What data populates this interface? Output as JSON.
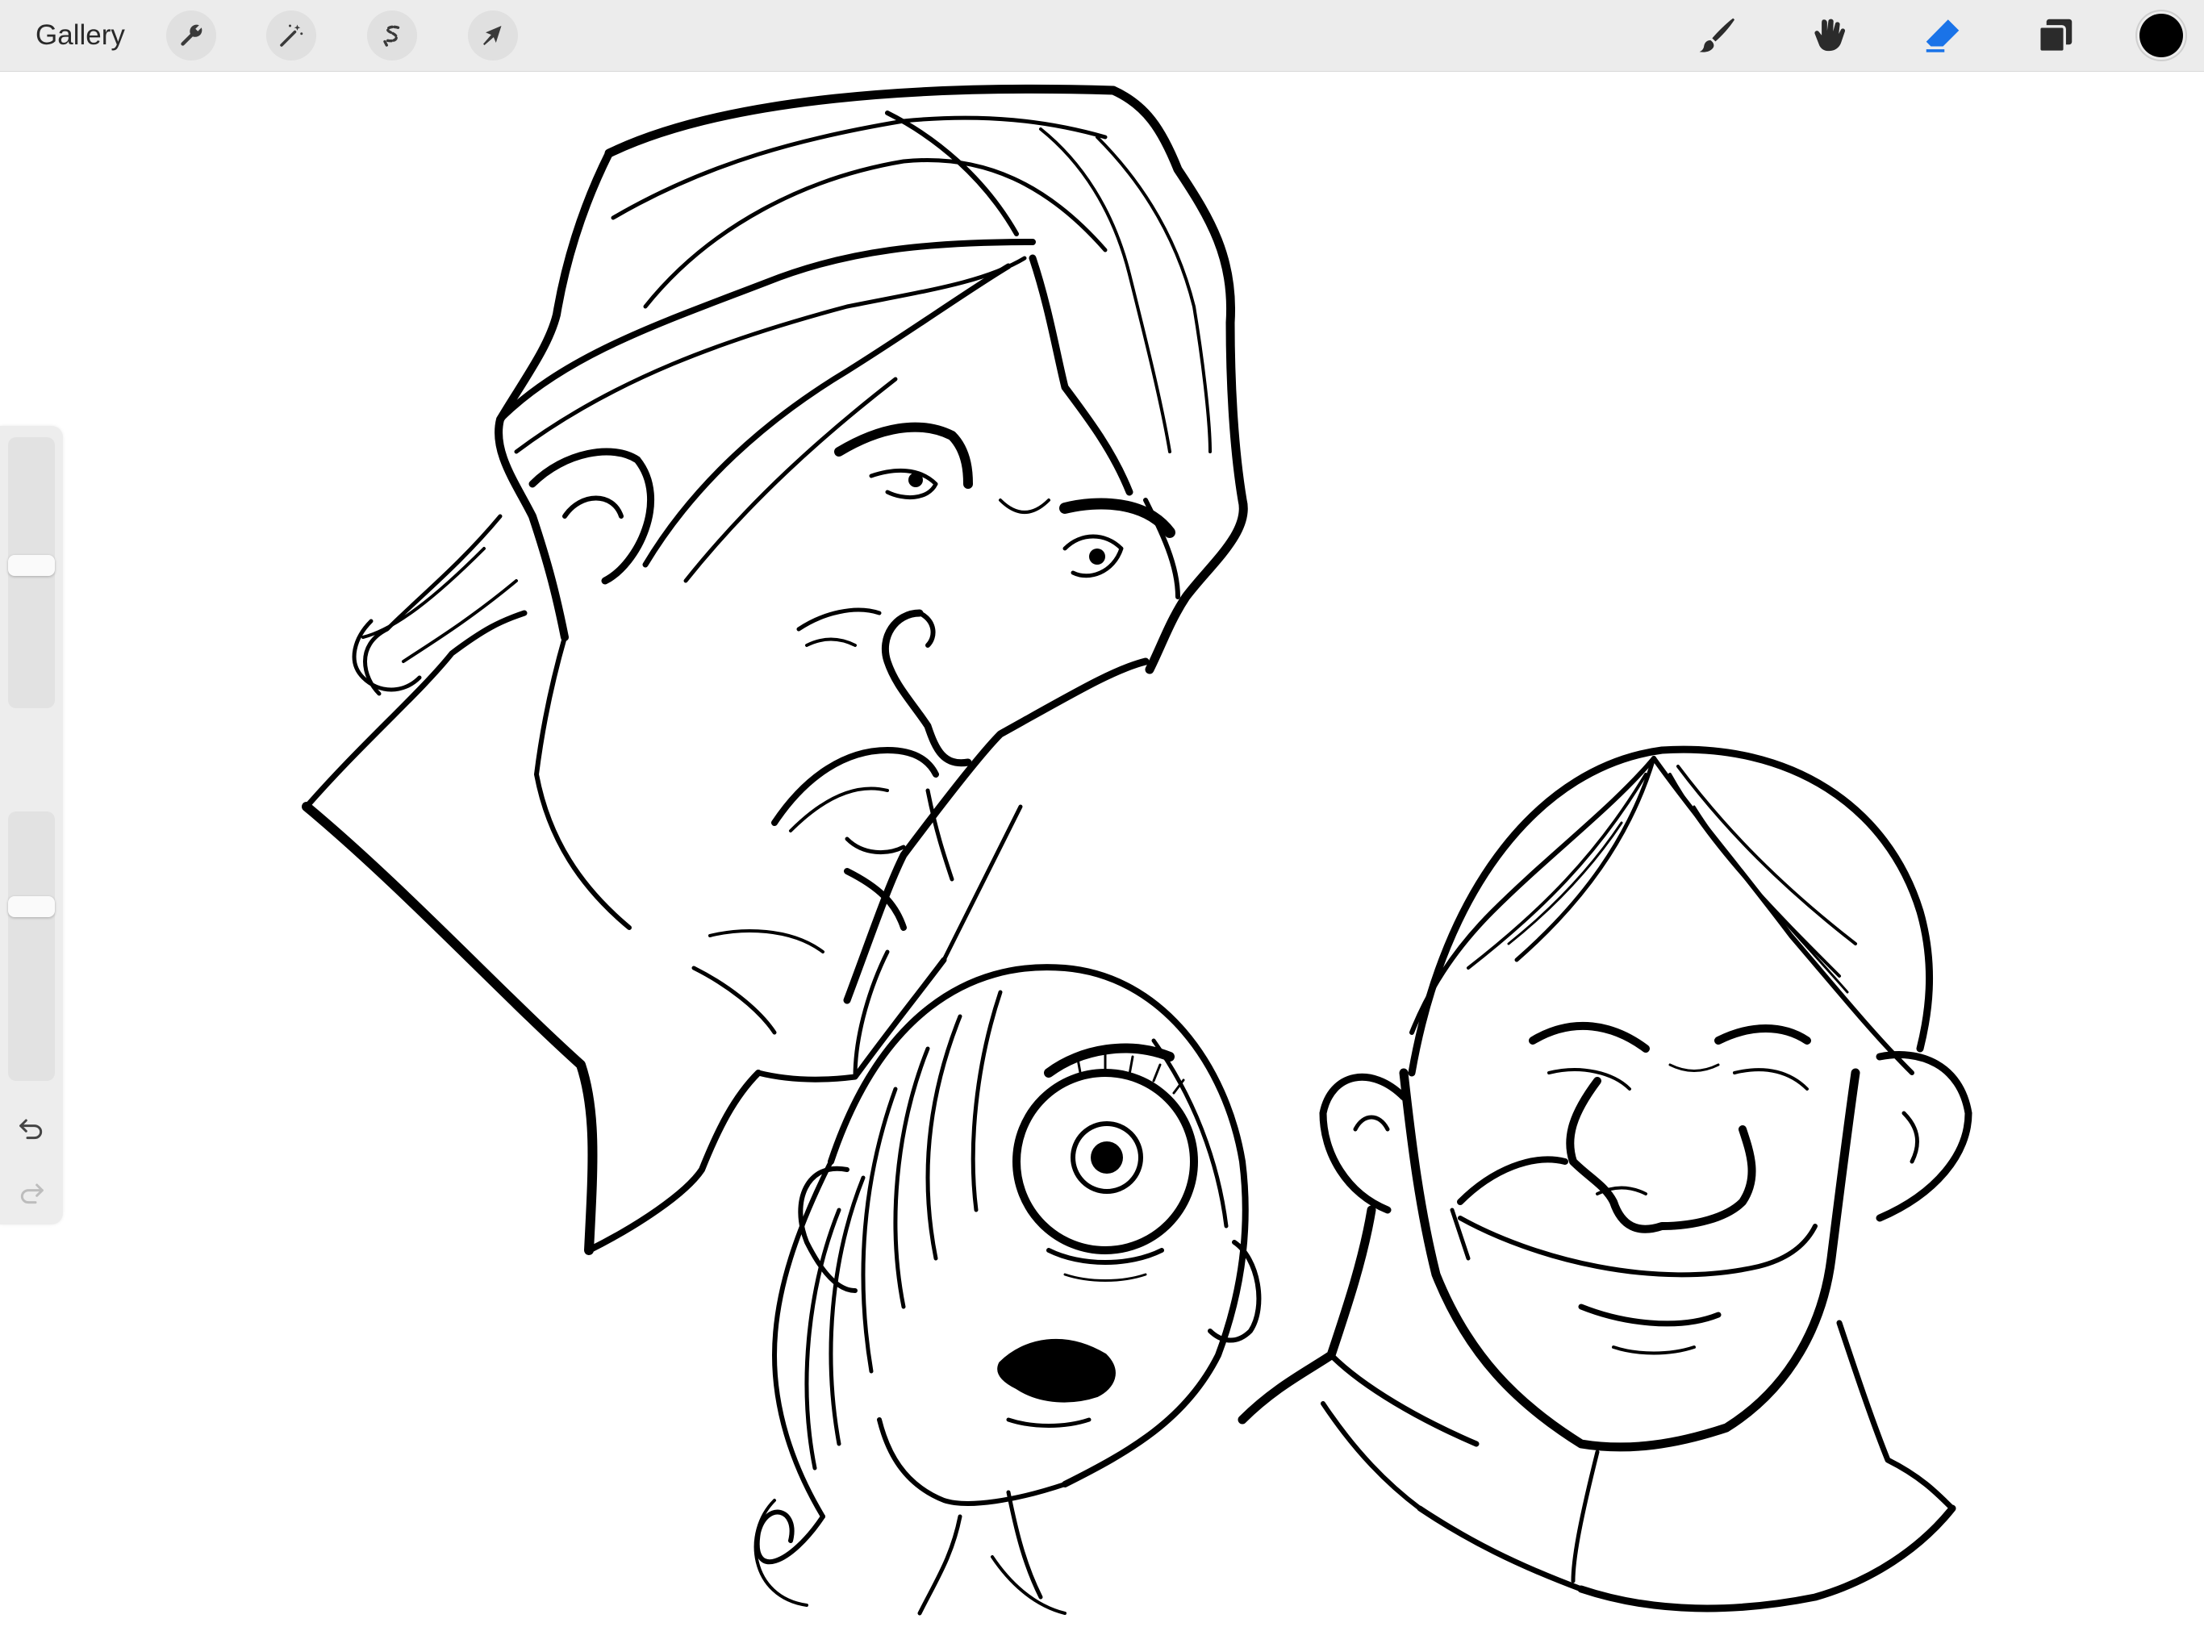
{
  "toolbar": {
    "gallery_label": "Gallery",
    "left_tools": [
      {
        "icon": "wrench-icon"
      },
      {
        "icon": "magic-wand-icon"
      },
      {
        "icon": "selection-icon"
      },
      {
        "icon": "transform-arrow-icon"
      }
    ],
    "right_tools": [
      {
        "icon": "brush-icon",
        "active": false
      },
      {
        "icon": "smudge-icon",
        "active": false
      },
      {
        "icon": "eraser-icon",
        "active": true
      },
      {
        "icon": "layers-icon",
        "active": false
      }
    ],
    "current_color": "#000000",
    "active_tool_color": "#1a73e8"
  },
  "sidebar": {
    "brush_size_level": 0.47,
    "brush_opacity_level": 0.34,
    "undo_icon": "undo-icon",
    "redo_icon": "redo-icon"
  }
}
